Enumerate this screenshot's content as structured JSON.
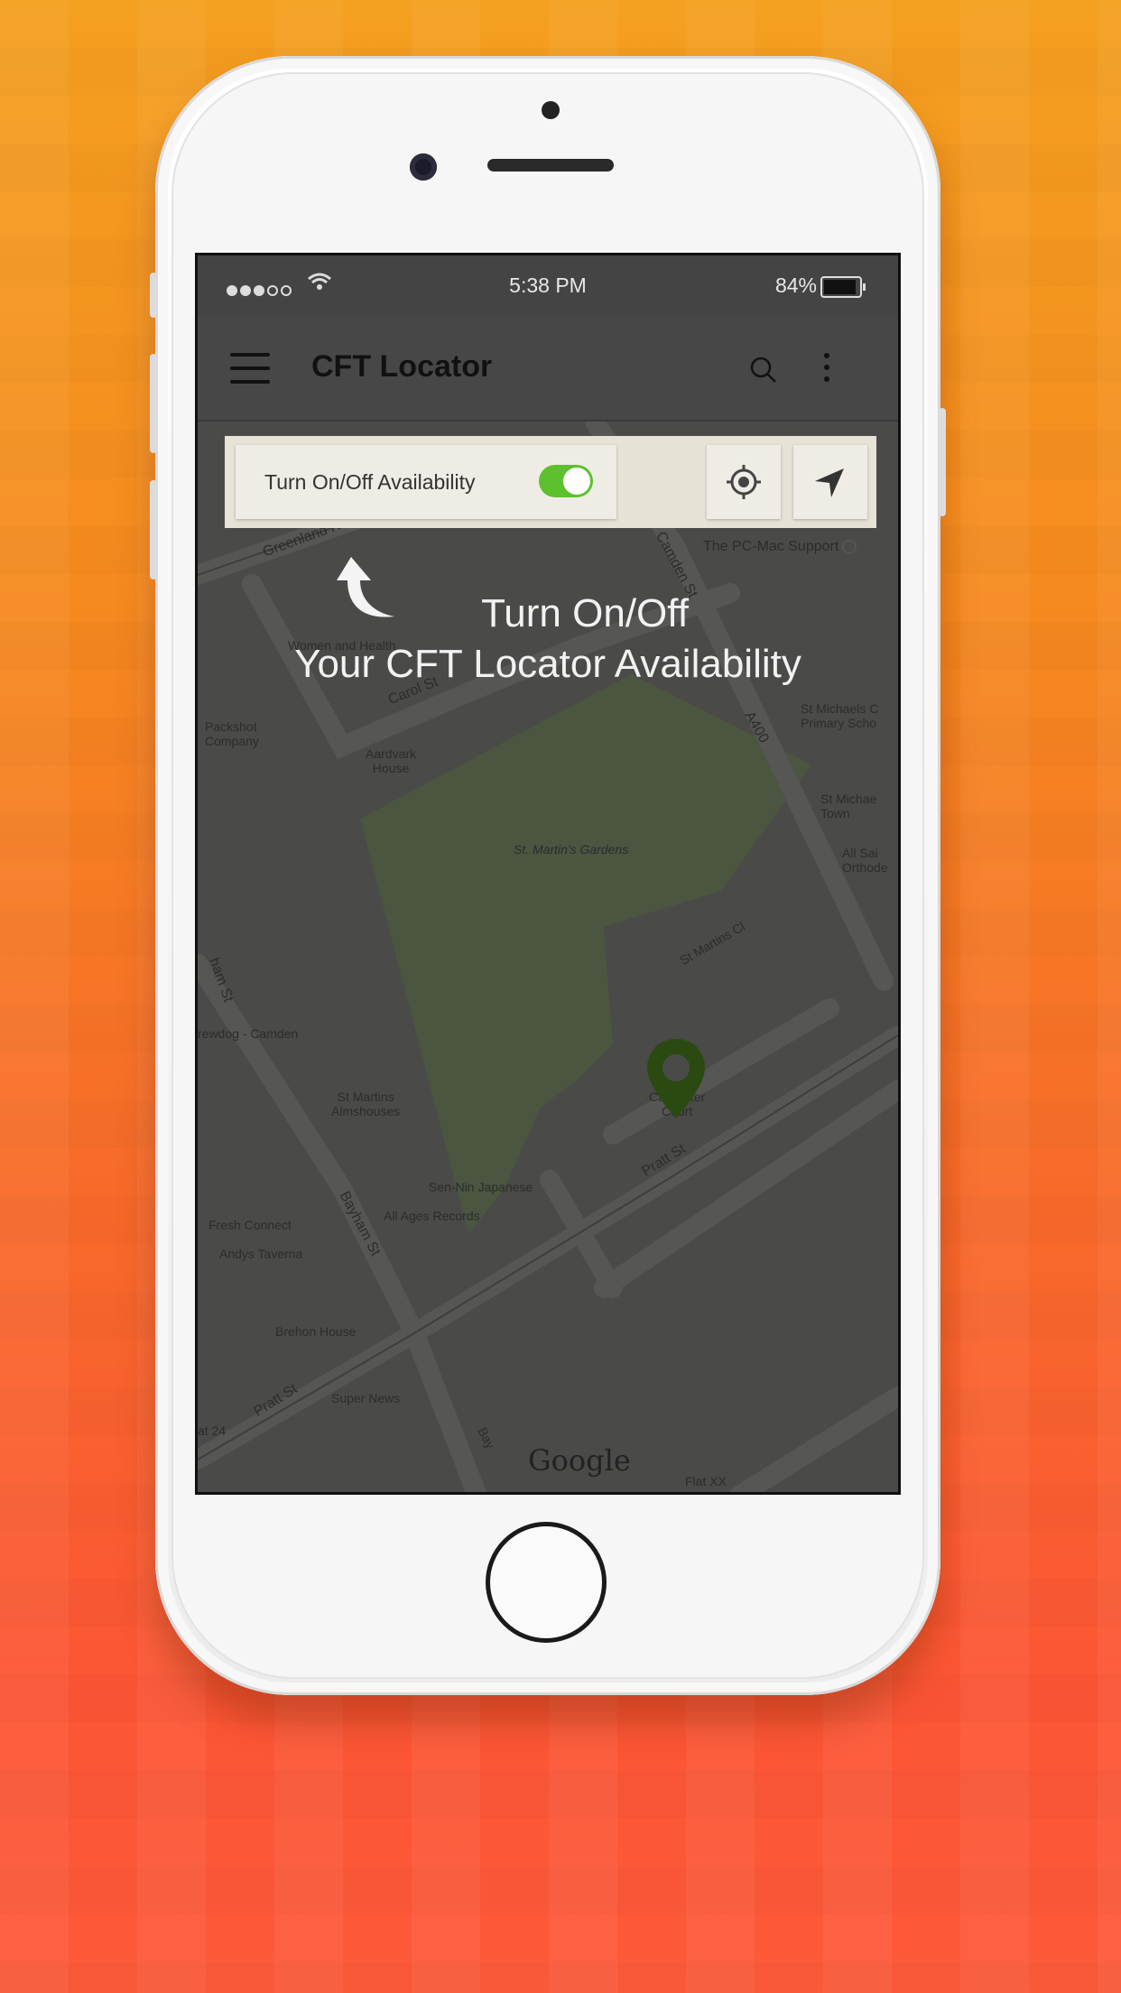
{
  "status_bar": {
    "time": "5:38 PM",
    "battery": "84%"
  },
  "app_bar": {
    "title": "CFT Locator"
  },
  "availability": {
    "label": "Turn On/Off Availability",
    "enabled": true
  },
  "tutorial": {
    "line1": "Turn On/Off",
    "line2": "Your CFT Locator Availability"
  },
  "map": {
    "labels": {
      "greenland": "Greenland Rd",
      "camden_st": "Camden St",
      "pc_mac": "The PC-Mac Support",
      "women_health": "Women and Health",
      "carol_st": "Carol St",
      "packshot": "Packshot\nCompany",
      "aardvark": "Aardvark\nHouse",
      "a400": "A400",
      "st_michaels": "St Michaels C\nPrimary Scho",
      "st_michael_town": "St Michae\nTown",
      "all_saints": "All Sai\nOrthode",
      "st_martins_gardens": "St. Martin's Gardens",
      "st_martins_cl": "St Martins Cl",
      "bayham_st_left": "ham St",
      "brewdog": "rewdog - Camden",
      "almshouses": "St Martins\nAlmshouses",
      "carpenter": "Carpenter\nCourt",
      "pratt_st": "Pratt St",
      "sen_nin": "Sen-Nin Japanese",
      "all_ages": "All Ages Records",
      "bayham_st": "Bayham St",
      "fresh_connect": "Fresh Connect",
      "andys": "Andys Taverna",
      "brehon": "Brehon House",
      "pratt_st_2": "Pratt St",
      "super_news": "Super News",
      "num24": "at 24",
      "bay": "Bay",
      "flat": "Flat XX",
      "google": "Google"
    }
  },
  "colors": {
    "toggle_on": "#5cc12d",
    "pin": "#2a4a12",
    "park": "#4b5540"
  }
}
